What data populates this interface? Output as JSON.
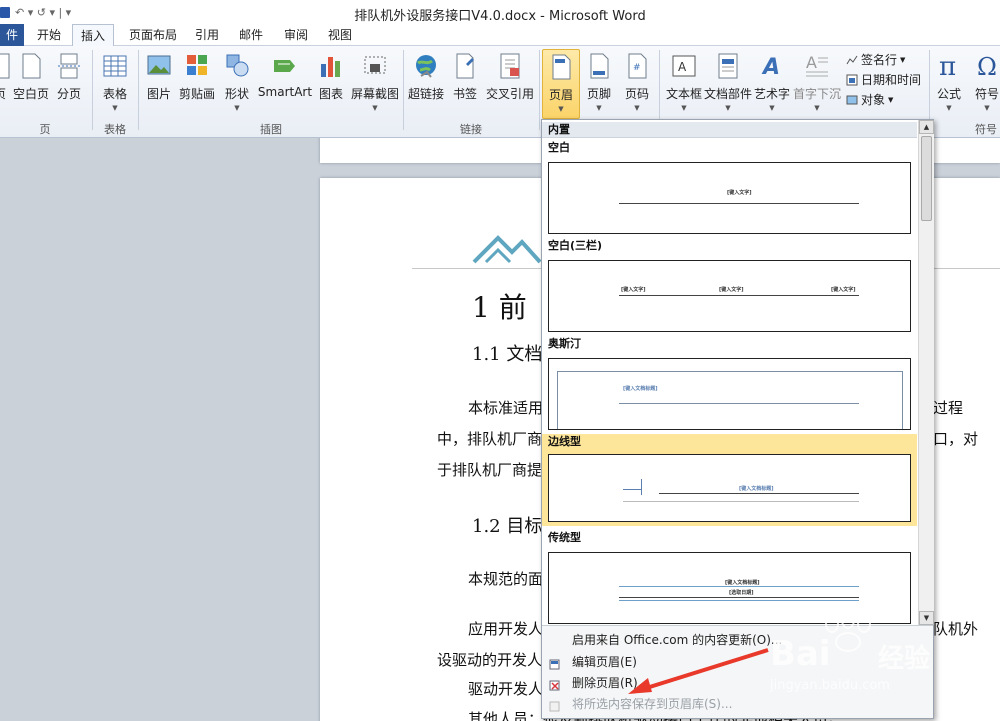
{
  "window": {
    "title": "排队机外设服务接口V4.0.docx - Microsoft Word",
    "qat": "↶ ▾ ↺ ▾ | ▾"
  },
  "tabs": [
    "件",
    "开始",
    "插入",
    "页面布局",
    "引用",
    "邮件",
    "审阅",
    "视图"
  ],
  "ribbon": {
    "pages_group": {
      "label": "页",
      "buttons": [
        "页",
        "空白页",
        "分页"
      ]
    },
    "tables_group": {
      "label": "表格",
      "buttons": [
        "表格"
      ]
    },
    "illustrations_group": {
      "label": "插图",
      "buttons": [
        "图片",
        "剪贴画",
        "形状",
        "SmartArt",
        "图表",
        "屏幕截图"
      ]
    },
    "links_group": {
      "label": "链接",
      "buttons": [
        "超链接",
        "书签",
        "交叉引用"
      ]
    },
    "header_footer_group": {
      "buttons": [
        "页眉",
        "页脚",
        "页码"
      ]
    },
    "text_group": {
      "buttons": [
        "文本框",
        "文档部件",
        "艺术字",
        "首字下沉"
      ],
      "small": [
        "签名行",
        "日期和时间",
        "对象"
      ]
    },
    "symbols_group": {
      "label": "符号",
      "buttons": [
        "公式",
        "符号"
      ]
    },
    "colors": {
      "accent": "#2b579a",
      "highlight": "#fbd46a"
    }
  },
  "document": {
    "heading1": "1 前",
    "heading1_1": "1.1 文档",
    "para1_a": "本标准适用",
    "para1_a_tail": "过程",
    "para1_b": "中，排队机厂商",
    "para1_b_tail": "口，对",
    "para1_c": "于排队机厂商提",
    "heading1_2": "1.2 目标",
    "para2": "本规范的面",
    "para3_a": "应用开发人",
    "para3_a_tail": "队机外",
    "para3_b": "设驱动的开发人",
    "para4": "驱动开发人",
    "para5": "其他人员：很及到排队机驱动接口工作的非他相关人员。"
  },
  "gallery": {
    "section_builtin": "内置",
    "items": [
      {
        "name": "空白",
        "placeholders": [
          "[键入文字]"
        ]
      },
      {
        "name": "空白(三栏)",
        "placeholders": [
          "[键入文字]",
          "[键入文字]",
          "[键入文字]"
        ]
      },
      {
        "name": "奥斯汀",
        "placeholders": [
          "[键入文档标题]"
        ]
      },
      {
        "name": "边线型",
        "placeholders": [
          "[键入文档标题]"
        ]
      },
      {
        "name": "传统型",
        "placeholders": [
          "[键入文档标题]",
          "[选取日期]"
        ]
      }
    ],
    "menu": [
      {
        "label": "启用来自 Office.com 的内容更新(O)...",
        "enabled": true
      },
      {
        "label": "编辑页眉(E)",
        "enabled": true
      },
      {
        "label": "删除页眉(R)",
        "enabled": true
      },
      {
        "label": "将所选内容保存到页眉库(S)...",
        "enabled": false
      }
    ]
  },
  "watermark": {
    "brand": "Bai",
    "brand_cn": "经验",
    "url": "jingyan.baidu.com"
  }
}
